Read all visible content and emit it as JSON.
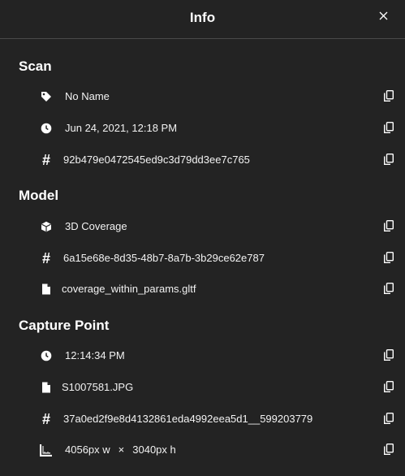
{
  "header": {
    "title": "Info"
  },
  "sections": {
    "scan": {
      "title": "Scan",
      "name": "No Name",
      "date": "Jun 24, 2021, 12:18 PM",
      "id": "92b479e0472545ed9c3d79dd3ee7c765"
    },
    "model": {
      "title": "Model",
      "type": "3D Coverage",
      "id": "6a15e68e-8d35-48b7-8a7b-3b29ce62e787",
      "file": "coverage_within_params.gltf"
    },
    "capture": {
      "title": "Capture Point",
      "time": "12:14:34 PM",
      "file": "S1007581.JPG",
      "id": "37a0ed2f9e8d4132861eda4992eea5d1__599203779",
      "width": "4056px w",
      "times": "×",
      "height": "3040px h"
    }
  },
  "colors": {
    "background": "#232323",
    "divider": "#4a4a4a",
    "text": "#ffffff"
  }
}
